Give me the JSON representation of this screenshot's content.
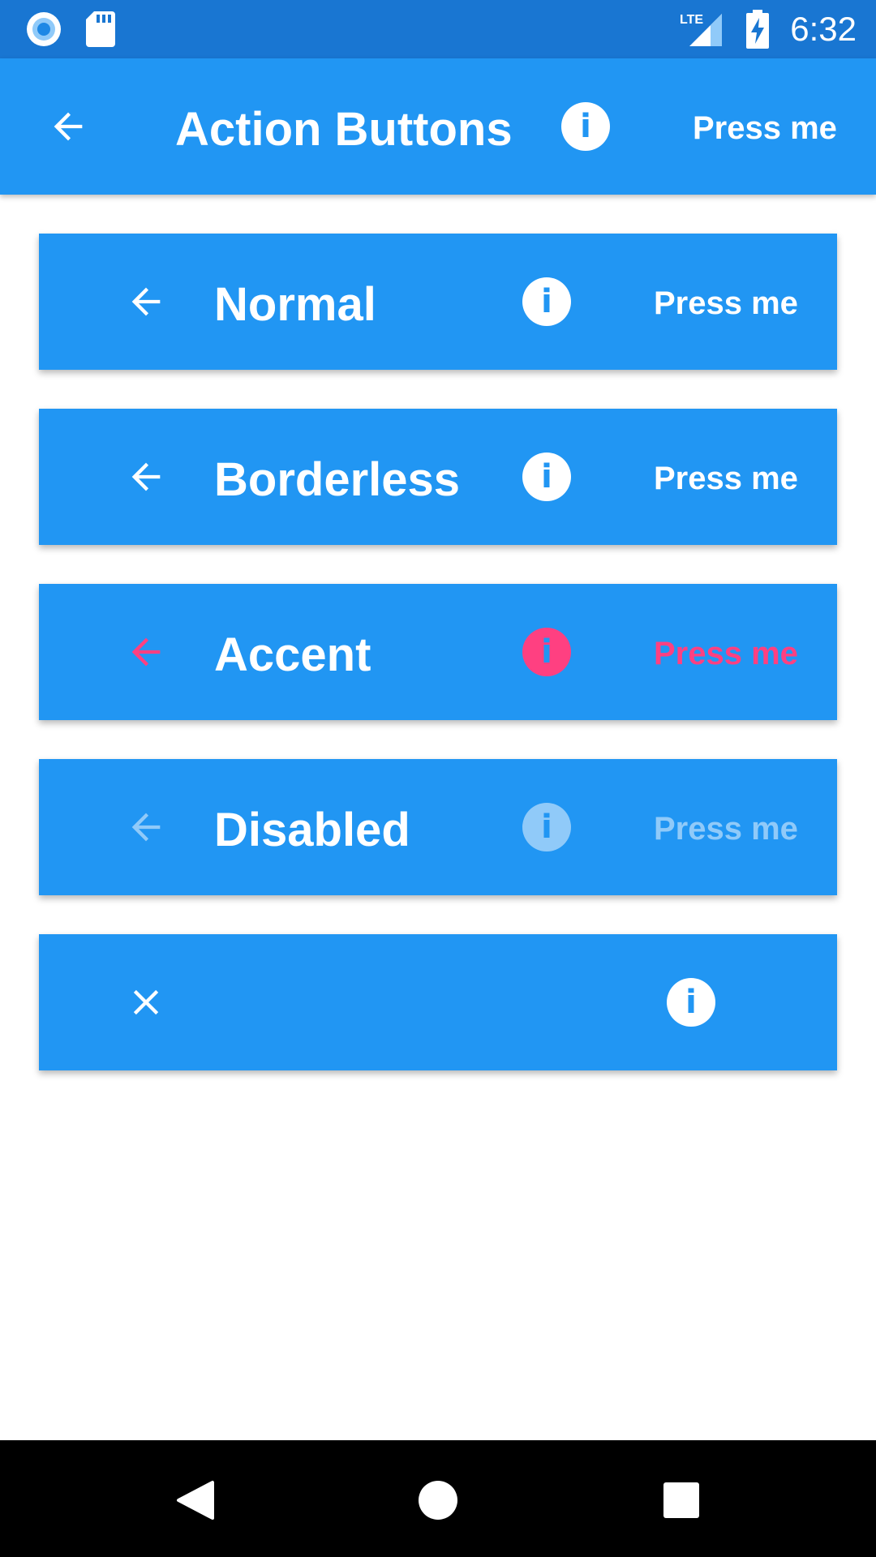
{
  "status_bar": {
    "time": "6:32",
    "network": "LTE",
    "icons": [
      "chrome-circle-icon",
      "sd-card-icon",
      "signal-icon",
      "battery-charging-icon"
    ]
  },
  "app_bar": {
    "title": "Action Buttons",
    "action_label": "Press me",
    "nav_icon": "back-arrow-icon",
    "info_icon_glyph": "i"
  },
  "cards": [
    {
      "title": "Normal",
      "action_label": "Press me",
      "info_icon_glyph": "i",
      "variant": "normal"
    },
    {
      "title": "Borderless",
      "action_label": "Press me",
      "info_icon_glyph": "i",
      "variant": "borderless"
    },
    {
      "title": "Accent",
      "action_label": "Press me",
      "info_icon_glyph": "i",
      "variant": "accent"
    },
    {
      "title": "Disabled",
      "action_label": "Press me",
      "info_icon_glyph": "i",
      "variant": "disabled"
    },
    {
      "title": "",
      "info_icon_glyph": "i",
      "variant": "close"
    }
  ],
  "colors": {
    "primary": "#2196F3",
    "primary_dark": "#1976D2",
    "accent": "#FF4081",
    "disabled": "#90CAF9",
    "on_primary": "#FFFFFF",
    "nav_bar": "#000000"
  },
  "nav_bar": {
    "buttons": [
      "back-triangle-icon",
      "home-circle-icon",
      "recents-square-icon"
    ]
  }
}
